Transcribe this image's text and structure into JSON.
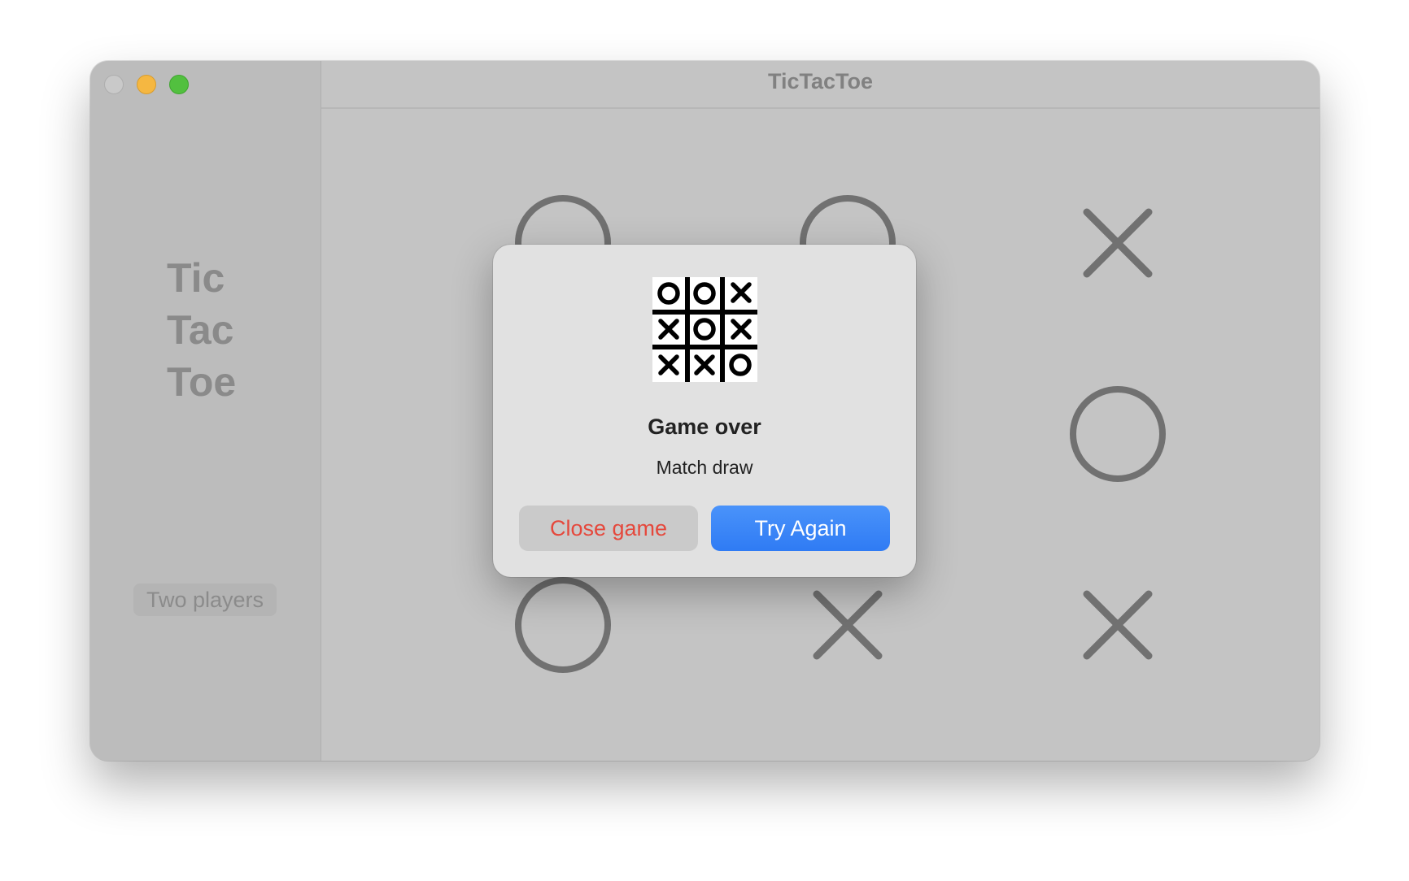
{
  "window": {
    "title": "TicTacToe"
  },
  "sidebar": {
    "title_lines": [
      "Tic",
      "Tac",
      "Toe"
    ],
    "mode_label": "Two players"
  },
  "board": {
    "cells": [
      "O",
      "O",
      "X",
      "",
      "",
      "O",
      "O",
      "X",
      "X"
    ],
    "mark_color": "#717171"
  },
  "dialog": {
    "icon": "tic-tac-toe-board-icon",
    "title": "Game over",
    "message": "Match draw",
    "close_label": "Close game",
    "retry_label": "Try Again"
  },
  "colors": {
    "destructive": "#e5483c",
    "accent": "#3b82f6"
  }
}
